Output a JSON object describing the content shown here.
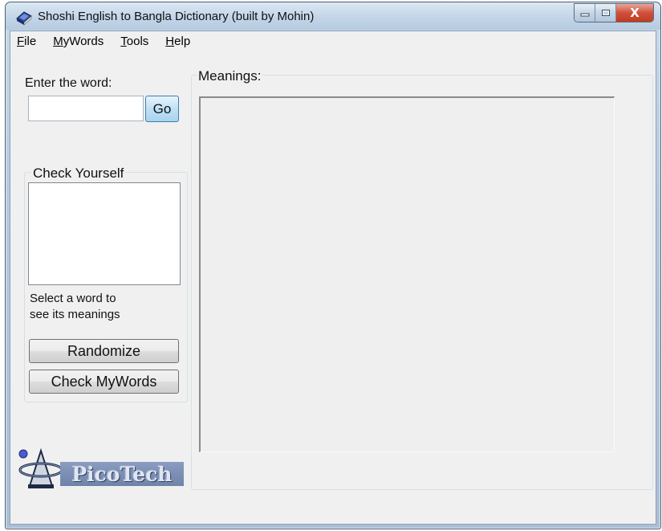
{
  "window": {
    "title": "Shoshi English to Bangla Dictionary (built by Mohin)",
    "controls": {
      "minimize_icon": "minimize-icon",
      "maximize_icon": "maximize-icon",
      "close_label": "X"
    }
  },
  "menu": {
    "items": [
      {
        "accel": "F",
        "rest": "ile"
      },
      {
        "accel": "M",
        "rest": "yWords"
      },
      {
        "accel": "T",
        "rest": "ools"
      },
      {
        "accel": "H",
        "rest": "elp"
      }
    ]
  },
  "search": {
    "label": "Enter the word:",
    "value": "",
    "placeholder": "",
    "go_label": "Go"
  },
  "check_yourself": {
    "title": "Check Yourself",
    "items": [],
    "hint_line1": "Select a word to",
    "hint_line2": "see its meanings",
    "randomize_label": "Randomize",
    "check_mywords_label": "Check MyWords"
  },
  "meanings": {
    "title": "Meanings:",
    "content": ""
  },
  "logo": {
    "text": "PicoTech"
  },
  "colors": {
    "accent_button": "#bfe1f4",
    "close_button": "#c13b22",
    "window_frame": "#b4c9de",
    "client_bg": "#f0f0f0",
    "logo_box": "#6f82a8"
  }
}
